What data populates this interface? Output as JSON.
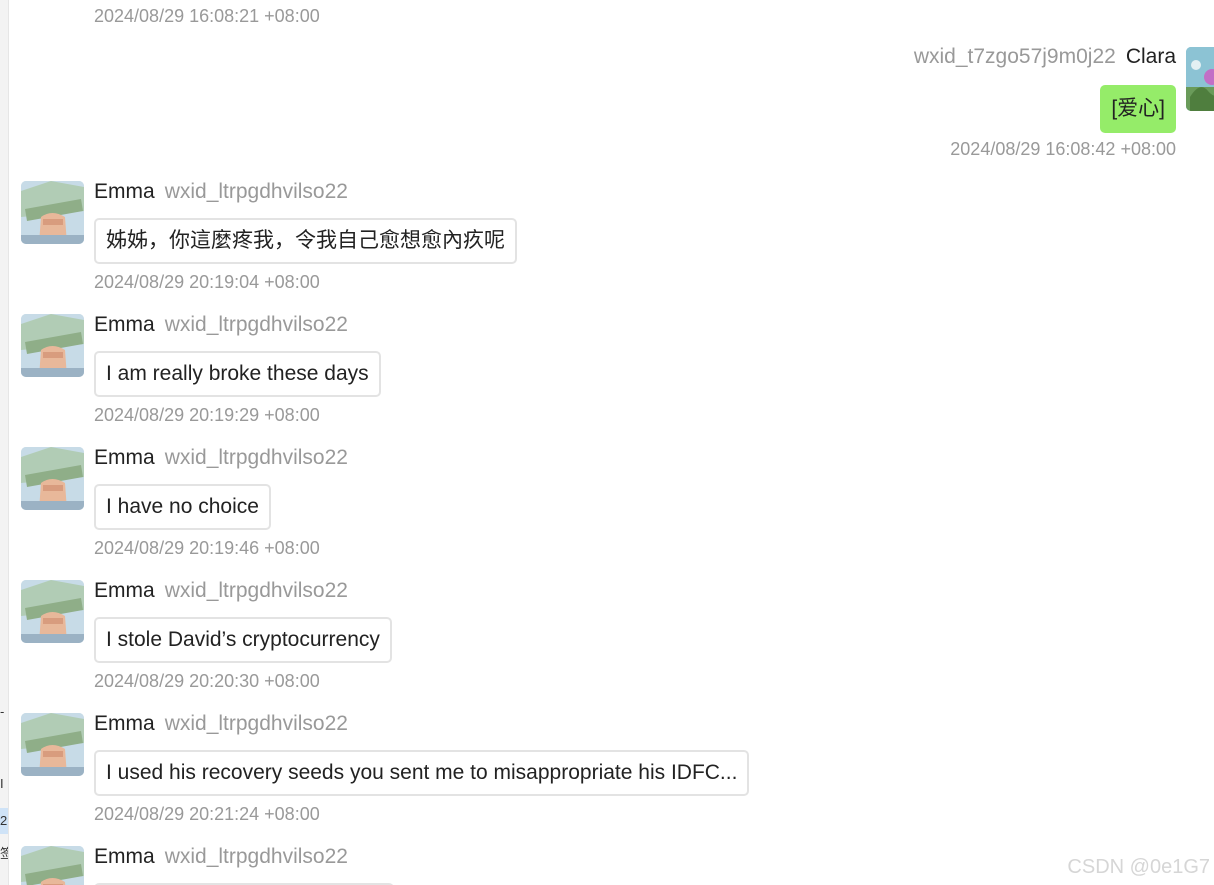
{
  "top_timestamp": "2024/08/29 16:08:21 +08:00",
  "outgoing": {
    "sender_id": "wxid_t7zgo57j9m0j22",
    "sender_name": "Clara",
    "text": "[爱心]",
    "timestamp": "2024/08/29 16:08:42 +08:00",
    "bubble_color": "#95ec69"
  },
  "messages": [
    {
      "name": "Emma",
      "id": "wxid_ltrpgdhvilso22",
      "text": "姊姊，你這麼疼我，令我自己愈想愈內疚呢",
      "timestamp": "2024/08/29 20:19:04 +08:00"
    },
    {
      "name": "Emma",
      "id": "wxid_ltrpgdhvilso22",
      "text": "I am really broke these days",
      "timestamp": "2024/08/29 20:19:29 +08:00"
    },
    {
      "name": "Emma",
      "id": "wxid_ltrpgdhvilso22",
      "text": "I have no choice",
      "timestamp": "2024/08/29 20:19:46 +08:00"
    },
    {
      "name": "Emma",
      "id": "wxid_ltrpgdhvilso22",
      "text": "I stole David’s cryptocurrency",
      "timestamp": "2024/08/29 20:20:30 +08:00"
    },
    {
      "name": "Emma",
      "id": "wxid_ltrpgdhvilso22",
      "text": "I used his recovery seeds you sent me to misappropriate his IDFC...",
      "timestamp": "2024/08/29 20:21:24 +08:00"
    },
    {
      "name": "Emma",
      "id": "wxid_ltrpgdhvilso22"
    }
  ],
  "left_strip_glyphs": [
    "-",
    "I",
    "2",
    "签"
  ],
  "watermark": "CSDN @0e1G7",
  "icons": {
    "emma_avatar": "hand-holding-money-avatar",
    "clara_avatar": "nature-photo-avatar"
  }
}
